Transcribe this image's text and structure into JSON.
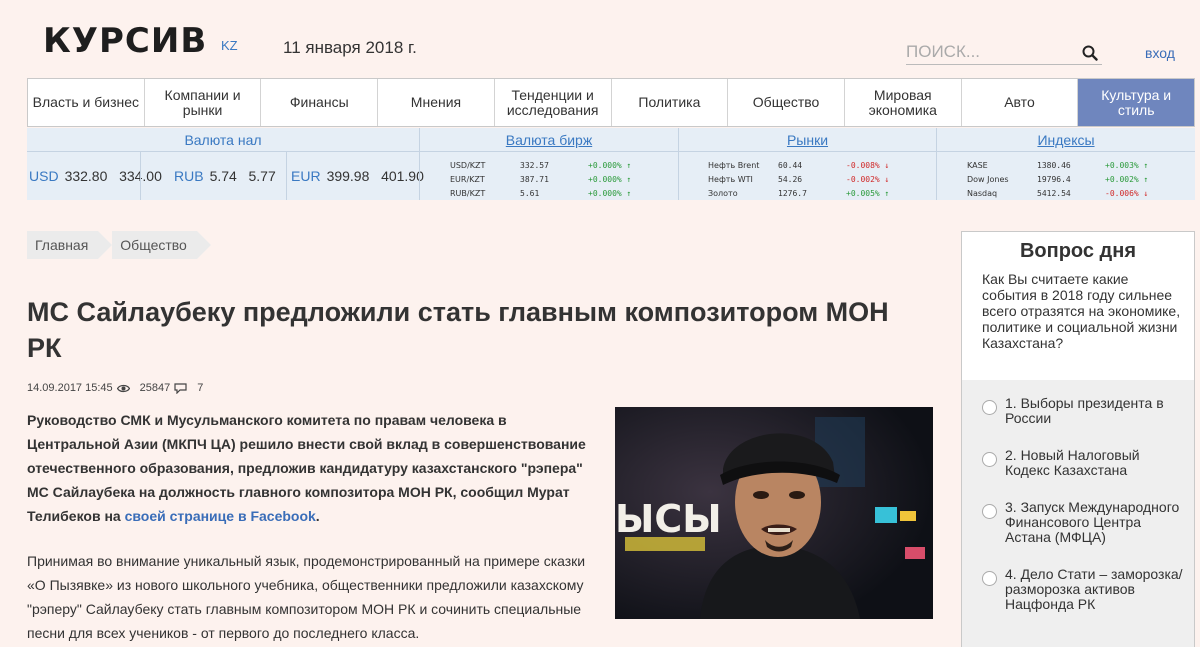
{
  "header": {
    "logo": "КУРСИВ",
    "logo_suffix": "KZ",
    "date": "11 января 2018 г.",
    "search_placeholder": "ПОИСК...",
    "login": "вход"
  },
  "nav": [
    {
      "label": "Власть и бизнес"
    },
    {
      "label": "Компании и рынки"
    },
    {
      "label": "Финансы"
    },
    {
      "label": "Мнения"
    },
    {
      "label": "Тенденции и исследования"
    },
    {
      "label": "Политика"
    },
    {
      "label": "Общество"
    },
    {
      "label": "Мировая экономика"
    },
    {
      "label": "Авто"
    },
    {
      "label": "Культура и стиль",
      "active": true
    }
  ],
  "fx": {
    "cash": {
      "title": "Валюта нал",
      "items": [
        {
          "code": "USD",
          "buy": "332.80",
          "sell": "334.00"
        },
        {
          "code": "RUB",
          "buy": "5.74",
          "sell": "5.77"
        },
        {
          "code": "EUR",
          "buy": "399.98",
          "sell": "401.90"
        }
      ]
    },
    "exchange": {
      "title": "Валюта бирж",
      "rows": [
        {
          "name": "USD/KZT",
          "value": "332.57",
          "change": "+0.000%",
          "dir": "up"
        },
        {
          "name": "EUR/KZT",
          "value": "387.71",
          "change": "+0.000%",
          "dir": "up"
        },
        {
          "name": "RUB/KZT",
          "value": "5.61",
          "change": "+0.000%",
          "dir": "up"
        }
      ]
    },
    "markets": {
      "title": "Рынки",
      "rows": [
        {
          "name": "Нефть Brent",
          "value": "60.44",
          "change": "-0.008%",
          "dir": "down"
        },
        {
          "name": "Нефть WTI",
          "value": "54.26",
          "change": "-0.002%",
          "dir": "down"
        },
        {
          "name": "Золото",
          "value": "1276.7",
          "change": "+0.005%",
          "dir": "up"
        }
      ]
    },
    "indices": {
      "title": "Индексы",
      "rows": [
        {
          "name": "KASE",
          "value": "1380.46",
          "change": "+0.003%",
          "dir": "up"
        },
        {
          "name": "Dow Jones",
          "value": "19796.4",
          "change": "+0.002%",
          "dir": "up"
        },
        {
          "name": "Nasdaq",
          "value": "5412.54",
          "change": "-0.006%",
          "dir": "down"
        }
      ]
    }
  },
  "breadcrumbs": [
    "Главная",
    "Общество"
  ],
  "article": {
    "title": "МС Сайлаубеку предложили стать главным композитором МОН РК",
    "date": "14.09.2017 15:45",
    "views": "25847",
    "comments": "7",
    "lead": "Руководство СМК и Мусульманского комитета по правам человека в Центральной Азии (МКПЧ ЦА) решило внести свой вклад в совершенствование отечественного образования, предложив кандидатуру казахстанского \"рэпера\" МС Сайлаубека на должность главного композитора МОН РК, сообщил Мурат Телибеков на ",
    "lead_link": "своей странице в Facebook",
    "lead_end": ".",
    "paragraph": "Принимая во внимание уникальный язык, продемонстрированный на примере сказки «О Пызявке» из нового школьного учебника, общественники предложили казахскому \"рэперу\" Сайлаубеку стать главным композитором МОН РК и сочинить специальные песни для всех учеников - от первого до последнего класса.",
    "photo_text": "ЫСЫ"
  },
  "poll": {
    "title": "Вопрос дня",
    "question": "Как Вы считаете какие события в 2018 году сильнее всего отразятся на экономике, политике и социальной жизни Казахстана?",
    "options": [
      "1. Выборы президента в России",
      "2. Новый Налоговый Кодекс Казахстана",
      "3. Запуск Международного Финансового Центра Астана (МФЦА)",
      "4. Дело Стати – заморозка/разморозка активов Нацфонда РК"
    ]
  },
  "colors": {
    "background": "#fdf2ee",
    "accent_blue": "#3a79c2",
    "nav_active": "#6f86be",
    "fx_panel": "#e6eef6",
    "up": "#2a9a3a",
    "down": "#d02828"
  }
}
